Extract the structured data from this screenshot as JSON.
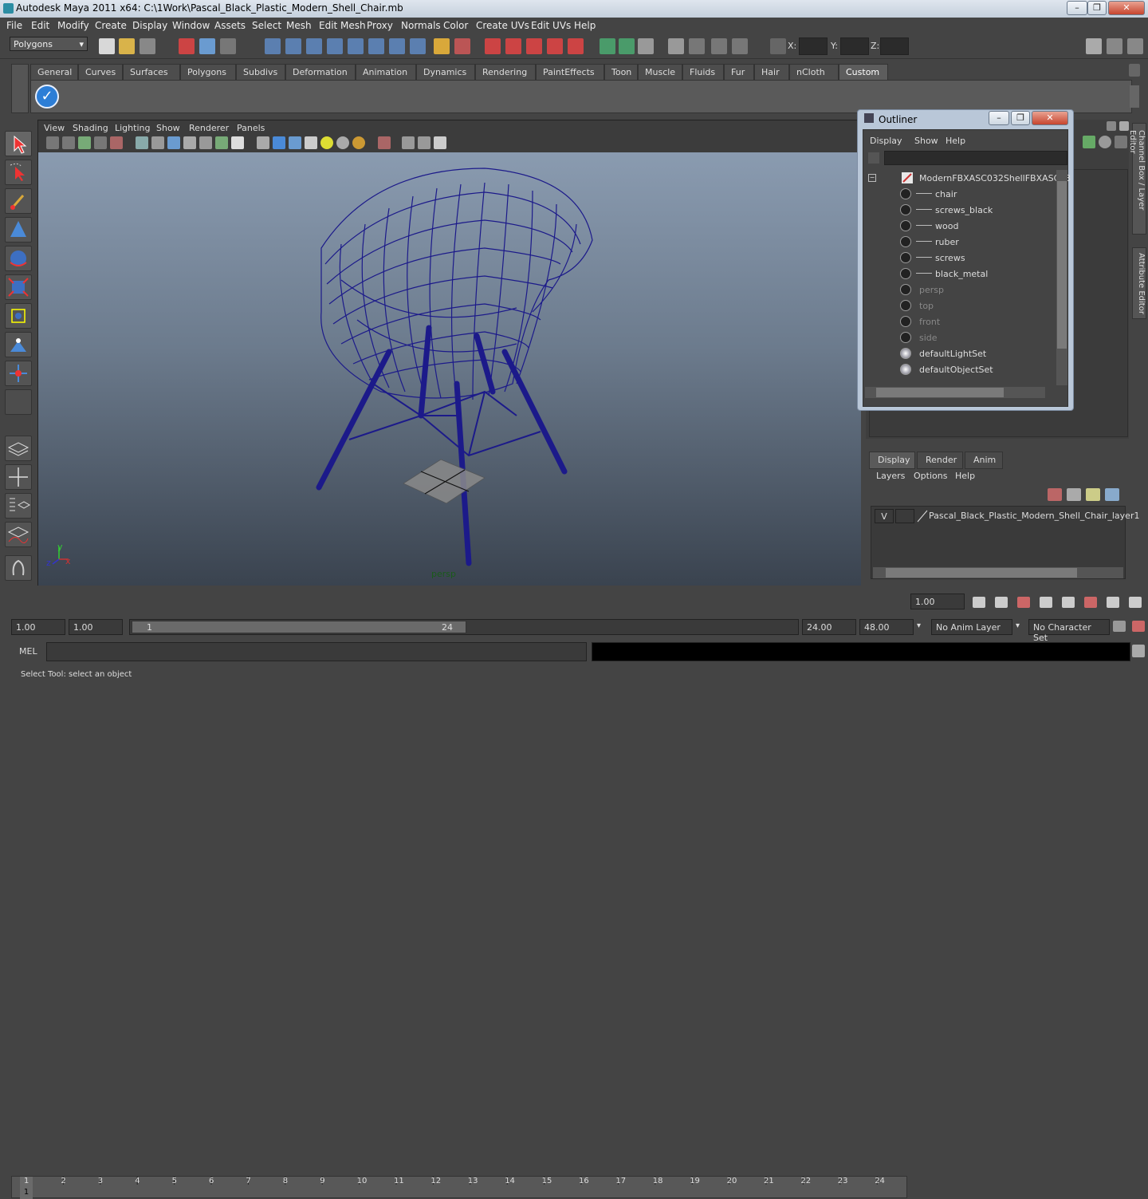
{
  "window": {
    "title": "Autodesk Maya 2011 x64: C:\\1Work\\Pascal_Black_Plastic_Modern_Shell_Chair.mb",
    "minimize": "–",
    "maximize": "❐",
    "close": "✕"
  },
  "menu": [
    "File",
    "Edit",
    "Modify",
    "Create",
    "Display",
    "Window",
    "Assets",
    "Select",
    "Mesh",
    "Edit Mesh",
    "Proxy",
    "Normals",
    "Color",
    "Create UVs",
    "Edit UVs",
    "Help"
  ],
  "status": {
    "menu_set": "Polygons",
    "x_label": "X:",
    "y_label": "Y:",
    "z_label": "Z:"
  },
  "shelf_tabs": [
    "General",
    "Curves",
    "Surfaces",
    "Polygons",
    "Subdivs",
    "Deformation",
    "Animation",
    "Dynamics",
    "Rendering",
    "PaintEffects",
    "Toon",
    "Muscle",
    "Fluids",
    "Fur",
    "Hair",
    "nCloth",
    "Custom"
  ],
  "shelf_active": "Custom",
  "viewport": {
    "menu": [
      "View",
      "Shading",
      "Lighting",
      "Show",
      "Renderer",
      "Panels"
    ],
    "camera_label": "persp",
    "axis_x": "x",
    "axis_y": "y",
    "axis_z": "z"
  },
  "outliner": {
    "title": "Outliner",
    "menu": [
      "Display",
      "Show",
      "Help"
    ],
    "items": [
      {
        "label": "ModernFBXASC032ShellFBXASC03",
        "dim": false
      },
      {
        "label": "chair",
        "dim": false
      },
      {
        "label": "screws_black",
        "dim": false
      },
      {
        "label": "wood",
        "dim": false
      },
      {
        "label": "ruber",
        "dim": false
      },
      {
        "label": "screws",
        "dim": false
      },
      {
        "label": "black_metal",
        "dim": false
      },
      {
        "label": "persp",
        "dim": true
      },
      {
        "label": "top",
        "dim": true
      },
      {
        "label": "front",
        "dim": true
      },
      {
        "label": "side",
        "dim": true
      },
      {
        "label": "defaultLightSet",
        "dim": false
      },
      {
        "label": "defaultObjectSet",
        "dim": false
      }
    ]
  },
  "side_tabs": {
    "channel_box": "Channel Box / Layer Editor",
    "attribute_editor": "Attribute Editor"
  },
  "layers": {
    "tabs": [
      "Display",
      "Render",
      "Anim"
    ],
    "active_tab": "Display",
    "menu": [
      "Layers",
      "Options",
      "Help"
    ],
    "layer_visible": "V",
    "layer_name": "Pascal_Black_Plastic_Modern_Shell_Chair_layer1"
  },
  "timeline": {
    "ticks": [
      "1",
      "2",
      "3",
      "4",
      "5",
      "6",
      "7",
      "8",
      "9",
      "10",
      "11",
      "12",
      "13",
      "14",
      "15",
      "16",
      "17",
      "18",
      "19",
      "20",
      "21",
      "22",
      "23",
      "24"
    ],
    "current": "1.00",
    "current_frame_marker": "1"
  },
  "range": {
    "start": "1.00",
    "start2": "1.00",
    "slider_start": "1",
    "slider_end": "24",
    "end": "24.00",
    "end2": "48.00",
    "anim_layer": "No Anim Layer",
    "char_set": "No Character Set"
  },
  "command": {
    "label": "MEL"
  },
  "help_line": "Select Tool: select an object"
}
